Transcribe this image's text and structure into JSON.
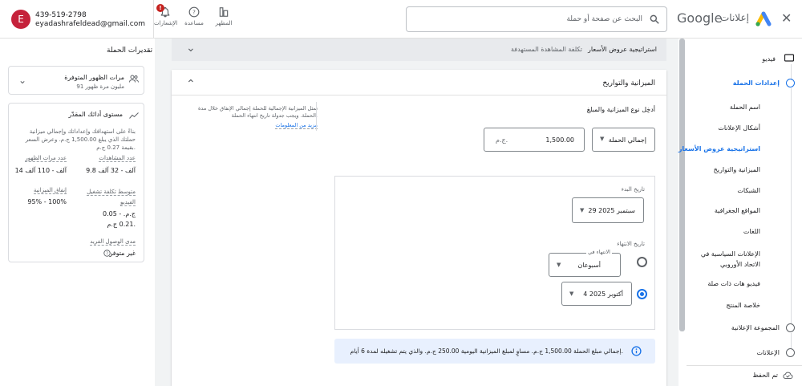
{
  "topbar": {
    "account": {
      "initial": "E",
      "phone": "439-519-2798",
      "email": "eyadashrafeldead@gmail.com"
    },
    "icons": [
      {
        "name": "notifications-icon",
        "label": "الإشعارات",
        "badge": "!"
      },
      {
        "name": "help-icon",
        "label": "مساعدة"
      },
      {
        "name": "appearance-icon",
        "label": "المظهر"
      }
    ],
    "search": {
      "placeholder": "البحث عن صفحة أو حملة"
    },
    "logo": {
      "brand": "Google",
      "product": "إعلانات"
    }
  },
  "estimates": {
    "title": "تقديرات الحملة",
    "impressions": {
      "label": "مرات الظهور المتوفرة",
      "sub": "91 مليون مرة ظهور"
    },
    "performance": {
      "title": "مستوى أدائك المقدّر",
      "desc": "بناءً على استهدافك وإعداداتك وإجمالي ميزانية حملتك الذي يبلغ 1,500.00 ج.م. وعرض السعر بقيمة 0.27 ج.م.",
      "views_label": "عدد المشاهدات",
      "views_value": "9.8 آلف - 32 آلف",
      "impr_label": "عدد مرات الظهور",
      "impr_value": "14 آلف - 110 آلف",
      "cpv_label": "متوسط تكلفة تشغيل الفيديو",
      "cpv_value": "0.05 ج.م. - 0.21 ج.م.",
      "spend_label": "إنفاق الميزانية",
      "spend_value": "95% - 100%",
      "reach_label": "مدى الوصول الفريد",
      "reach_value": "غير متوفر"
    }
  },
  "strategy": {
    "title": "استراتيجية عروض الأسعار",
    "value": "تكلفة المشاهدة المستهدفة"
  },
  "budget": {
    "title": "الميزانية والتواريخ",
    "type_label": "أدخِل نوع الميزانية والمبلغ",
    "type_value": "إجمالي الحملة",
    "amount": "1,500.00",
    "currency": "ج.م.",
    "help_text": "تمثل الميزانية الإجمالية للحملة إجمالي الإنفاق خلال مدة الحملة. ويجب جدولة تاريخ انتهاء الحملة.",
    "help_link": "مزيد من المعلومات",
    "start_label": "تاريخ البدء",
    "start_value": "29 سبتمبر 2025",
    "end_label": "تاريخ الانتهاء",
    "end_in_label": "الانتهاء في",
    "end_in_value": "أسبوعان",
    "end_date_value": "4 أكتوبر 2025",
    "info_text": "إجمالي مبلغ الحملة 1,500.00 ج.م. مساوٍ لمبلغ الميزانية اليومية 250.00 ج.م. والذي يتم تشغيله لمدة 6 أيام."
  },
  "nav": {
    "video": "فيديو",
    "campaign_settings": "إعدادات الحملة",
    "items": [
      "اسم الحملة",
      "أشكال الإعلانات",
      "استراتيجية عروض الأسعار",
      "الميزانية والتواريخ",
      "الشبكات",
      "المواقع الجغرافية",
      "اللغات",
      "الإعلانات السياسية في الاتحاد الأوروبي",
      "فيديو هات ذات صلة",
      "خلاصة المنتج"
    ],
    "ad_group": "المجموعة الإعلانية",
    "ads": "الإعلانات",
    "draft": "تم الحفظ"
  },
  "colors": {
    "accent": "#1a73e8",
    "info_bg": "#e8f0fe",
    "avatar": "#c5223b",
    "badge": "#c5221f"
  }
}
